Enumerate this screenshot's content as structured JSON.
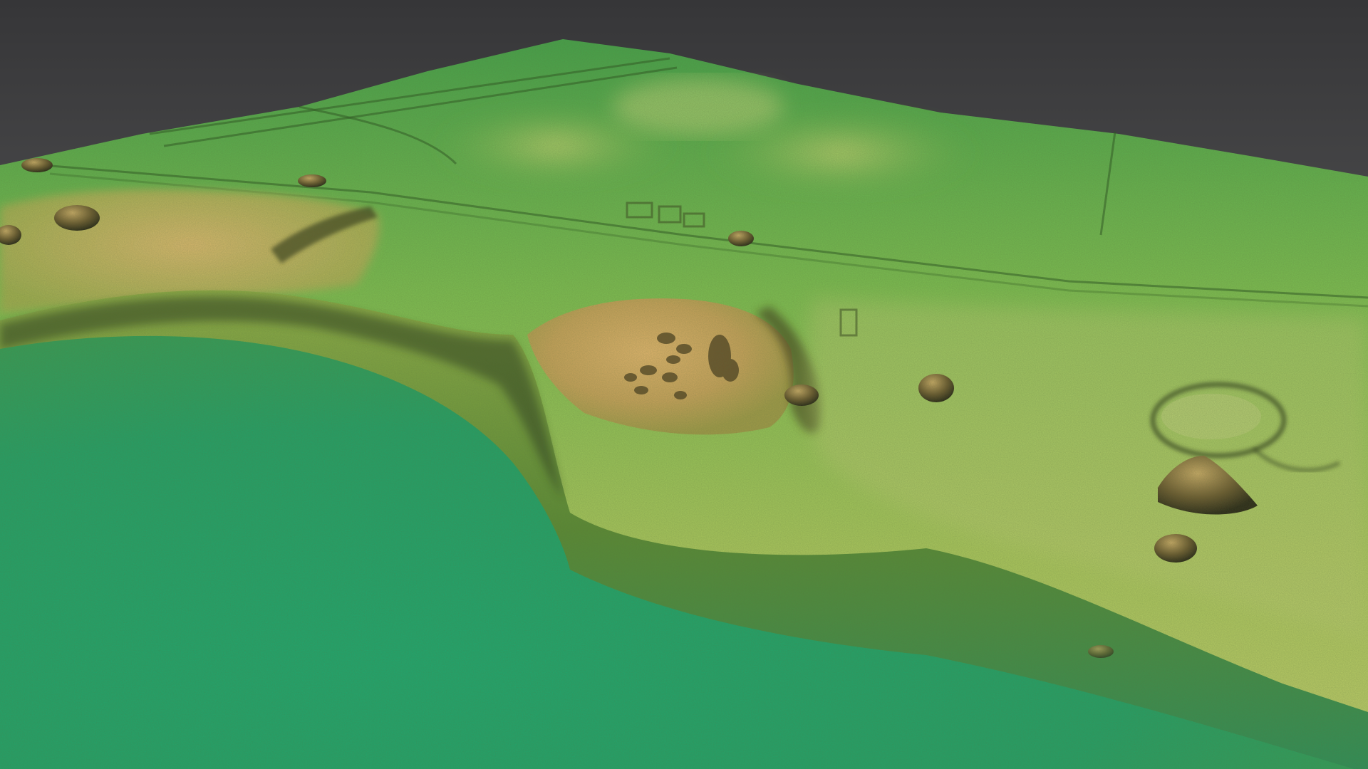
{
  "scene": {
    "description_type": "relief-shaded terrain elevation render",
    "colors": {
      "sky_top": "#3c3c3e",
      "sky_bottom": "#6e6e6e",
      "low_ground": "#1f9e68",
      "mid_ground": "#5cb848",
      "high_ground": "#a8c45a",
      "mound_peak": "#d2aa62",
      "shadow": "#2b3a1c"
    }
  }
}
